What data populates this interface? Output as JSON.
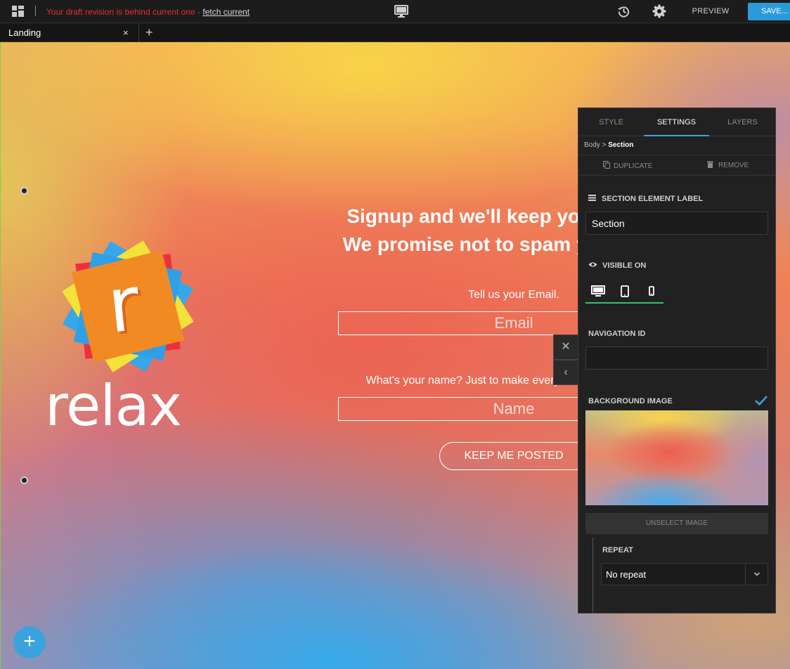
{
  "topbar": {
    "notice": "Your draft revision is behind current one -",
    "notice_link": "fetch current",
    "preview_label": "PREVIEW",
    "save_label": "SAVE..."
  },
  "tabs": [
    {
      "label": "Landing",
      "close": "×"
    }
  ],
  "tab_add": "+",
  "page": {
    "logo_text": "relax",
    "logo_letter": "r",
    "headline_line1": "Signup and we'll keep you updated.",
    "headline_line2": "We promise not to spam your inbox!",
    "email_label": "Tell us your Email.",
    "email_placeholder": "Email",
    "name_label": "What's your name? Just to make everything extra personal.",
    "name_placeholder": "Name",
    "submit_label": "KEEP ME POSTED",
    "fab_label": "+",
    "close_float": "✕",
    "collapse_float": "‹"
  },
  "panel": {
    "tabs": [
      {
        "label": "STYLE"
      },
      {
        "label": "SETTINGS",
        "active": true
      },
      {
        "label": "LAYERS"
      }
    ],
    "breadcrumb_parent": "Body",
    "breadcrumb_sep": ">",
    "breadcrumb_current": "Section",
    "duplicate_label": "DUPLICATE",
    "remove_label": "REMOVE",
    "element_label_title": "SECTION ELEMENT LABEL",
    "element_label_value": "Section",
    "visible_on_title": "VISIBLE ON",
    "navigation_id_title": "NAVIGATION ID",
    "navigation_id_value": "",
    "background_image_title": "BACKGROUND IMAGE",
    "background_image_checked": true,
    "unselect_label": "UNSELECT IMAGE",
    "repeat_title": "REPEAT",
    "repeat_value": "No repeat"
  },
  "icons": {
    "apps": "apps-icon",
    "device": "desktop-icon",
    "history": "history-icon",
    "settings": "gear-icon"
  },
  "colors": {
    "accent": "#3aa3de",
    "alert": "#e0312f",
    "visible_underline": "#35c26b"
  }
}
